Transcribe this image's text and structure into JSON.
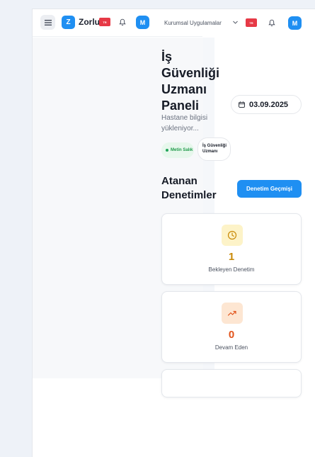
{
  "header": {
    "logo_letter": "Z",
    "logo_text": "Zorlu",
    "flag_label": "TR",
    "avatar_initial": "M",
    "corporate_apps_label": "Kurumsal Uygulamalar"
  },
  "page": {
    "title": "İş Güvenliği Uzmanı Paneli",
    "hospital_status": "Hastane bilgisi yükleniyor...",
    "date": "03.09.2025",
    "user_name": "Metin Salık",
    "role": "İş Güvenliği Uzmanı"
  },
  "inspections": {
    "title": "Atanan Denetimler",
    "history_button": "Denetim Geçmişi",
    "cards": [
      {
        "value": "1",
        "label": "Bekleyen Denetim",
        "icon": "clock-icon"
      },
      {
        "value": "0",
        "label": "Devam Eden",
        "icon": "trending-up-icon"
      }
    ]
  },
  "colors": {
    "accent": "#1f8ff2",
    "pending": "#c98a07",
    "in_progress": "#e2531a",
    "user_badge": "#1f9a4a"
  }
}
